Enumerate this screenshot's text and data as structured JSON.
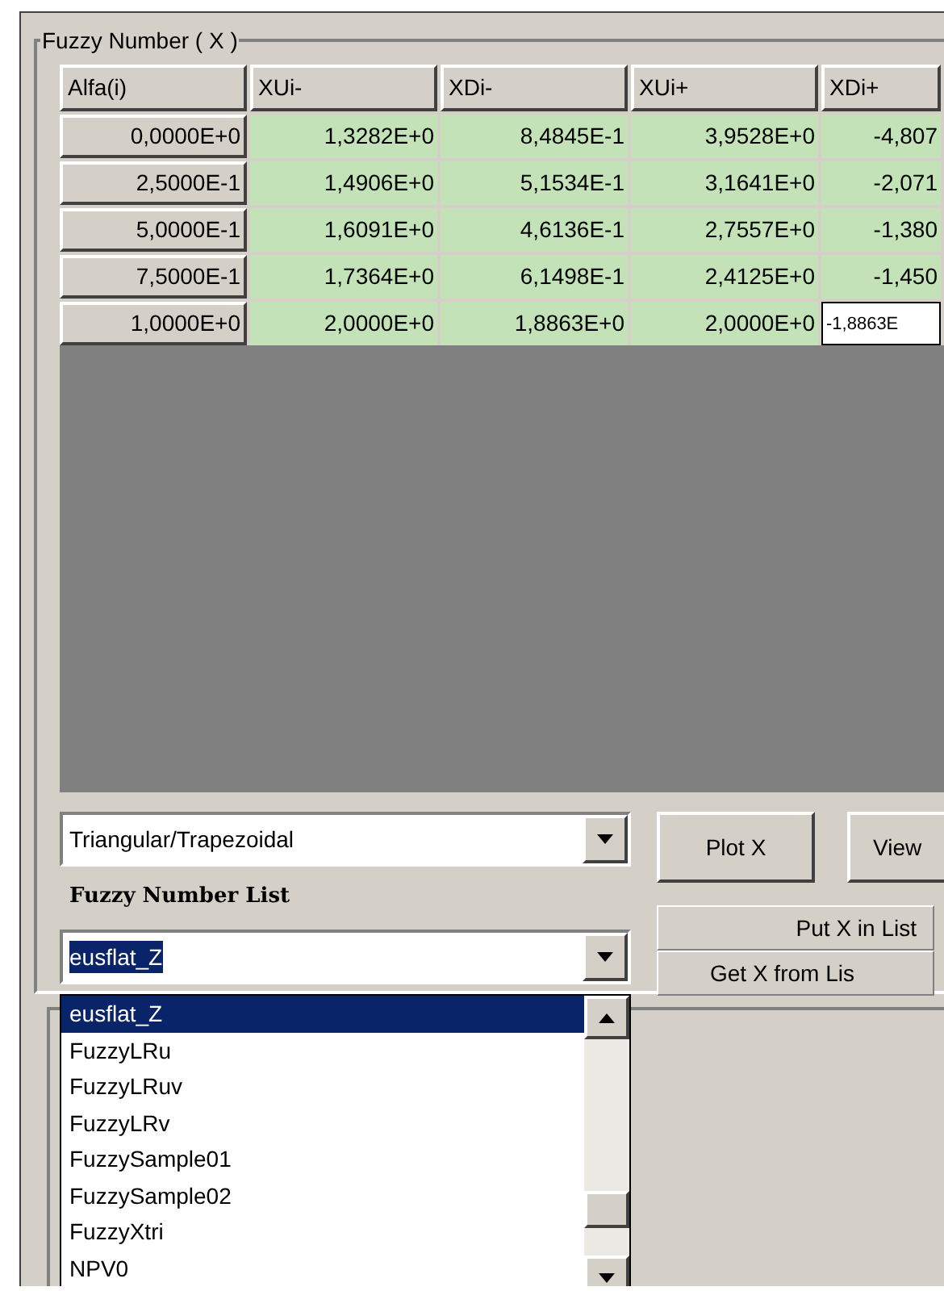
{
  "group": {
    "title": "Fuzzy Number ( X )"
  },
  "table": {
    "columns": [
      "Alfa(i)",
      "XUi-",
      "XDi-",
      "XUi+",
      "XDi+"
    ],
    "rows": [
      {
        "cells": [
          {
            "kind": "header",
            "text": "0,0000E+0",
            "editing": false
          },
          {
            "kind": "value",
            "text": "1,3282E+0",
            "editing": false
          },
          {
            "kind": "value",
            "text": "8,4845E-1",
            "editing": false
          },
          {
            "kind": "value",
            "text": "3,9528E+0",
            "editing": false
          },
          {
            "kind": "value",
            "text": "-4,807",
            "editing": false
          }
        ]
      },
      {
        "cells": [
          {
            "kind": "header",
            "text": "2,5000E-1",
            "editing": false
          },
          {
            "kind": "value",
            "text": "1,4906E+0",
            "editing": false
          },
          {
            "kind": "value",
            "text": "5,1534E-1",
            "editing": false
          },
          {
            "kind": "value",
            "text": "3,1641E+0",
            "editing": false
          },
          {
            "kind": "value",
            "text": "-2,071",
            "editing": false
          }
        ]
      },
      {
        "cells": [
          {
            "kind": "header",
            "text": "5,0000E-1",
            "editing": false
          },
          {
            "kind": "value",
            "text": "1,6091E+0",
            "editing": false
          },
          {
            "kind": "value",
            "text": "4,6136E-1",
            "editing": false
          },
          {
            "kind": "value",
            "text": "2,7557E+0",
            "editing": false
          },
          {
            "kind": "value",
            "text": "-1,380",
            "editing": false
          }
        ]
      },
      {
        "cells": [
          {
            "kind": "header",
            "text": "7,5000E-1",
            "editing": false
          },
          {
            "kind": "value",
            "text": "1,7364E+0",
            "editing": false
          },
          {
            "kind": "value",
            "text": "6,1498E-1",
            "editing": false
          },
          {
            "kind": "value",
            "text": "2,4125E+0",
            "editing": false
          },
          {
            "kind": "value",
            "text": "-1,450",
            "editing": false
          }
        ]
      },
      {
        "cells": [
          {
            "kind": "header",
            "text": "1,0000E+0",
            "editing": false
          },
          {
            "kind": "value",
            "text": "2,0000E+0",
            "editing": false
          },
          {
            "kind": "value",
            "text": "1,8863E+0",
            "editing": false
          },
          {
            "kind": "value",
            "text": "2,0000E+0",
            "editing": false
          },
          {
            "kind": "value",
            "text": "-1,8863E",
            "editing": true
          }
        ]
      }
    ]
  },
  "type_combo": {
    "value": "Triangular/Trapezoidal"
  },
  "buttons": [
    "Plot X",
    "View"
  ],
  "list_label": "Fuzzy Number List",
  "list_combo": {
    "value": "eusflat_Z",
    "expanded": true
  },
  "list_buttons": [
    "Put X in List",
    "Get X from Lis"
  ],
  "dropdown": [
    {
      "label": "eusflat_Z",
      "selected": true
    },
    {
      "label": "FuzzyLRu",
      "selected": false
    },
    {
      "label": "FuzzyLRuv",
      "selected": false
    },
    {
      "label": "FuzzyLRv",
      "selected": false
    },
    {
      "label": "FuzzySample01",
      "selected": false
    },
    {
      "label": "FuzzySample02",
      "selected": false
    },
    {
      "label": "FuzzyXtri",
      "selected": false
    },
    {
      "label": "NPV0",
      "selected": false
    }
  ]
}
